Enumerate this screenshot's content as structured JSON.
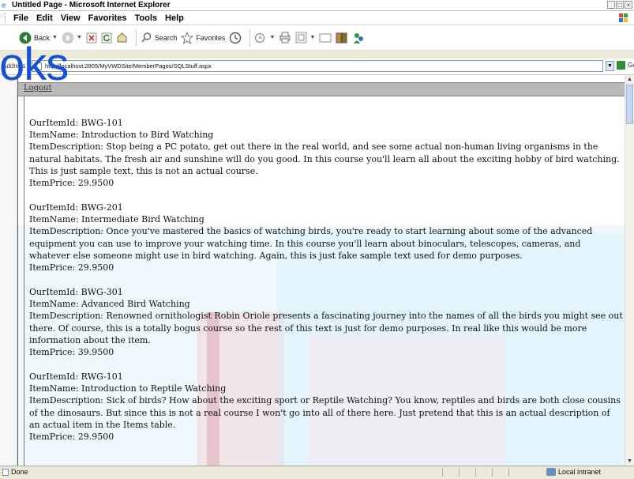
{
  "window": {
    "title": "Untitled Page - Microsoft Internet Explorer"
  },
  "menu": {
    "items": [
      "File",
      "Edit",
      "View",
      "Favorites",
      "Tools",
      "Help"
    ]
  },
  "toolbar": {
    "back_label": "Back",
    "search_label": "Search",
    "favorites_label": "Favorites"
  },
  "address": {
    "label": "Address",
    "url": "http://localhost:2805/MyVWDSite/MemberPages/SQLStuff.aspx",
    "go_label": "Go"
  },
  "watermark": {
    "logo_fragment": "oks"
  },
  "page": {
    "logout_label": "Logout",
    "records": [
      {
        "id": "OurItemId: BWG-101",
        "name": "ItemName: Introduction to Bird Watching",
        "description": "ItemDescription: Stop being a PC potato, get out there in the real world, and see some actual non-human living organisms in the natural habitats. The fresh air and sunshine will do you good. In this course you'll learn all about the exciting hobby of bird watching. This is just sample text, this is not an actual course.",
        "price": "ItemPrice: 29.9500"
      },
      {
        "id": "OurItemId: BWG-201",
        "name": "ItemName: Intermediate Bird Watching",
        "description": "ItemDescription: Once you've mastered the basics of watching birds, you're ready to start learning about some of the advanced equipment you can use to improve your watching time. In this course you'll learn about binoculars, telescopes, cameras, and whatever else someone might use in bird watching. Again, this is just fake sample text used for demo purposes.",
        "price": "ItemPrice: 29.9500"
      },
      {
        "id": "OurItemId: BWG-301",
        "name": "ItemName: Advanced Bird Watching",
        "description": "ItemDescription: Renowned ornithologist Robin Oriole presents a fascinating journey into the names of all the birds you might see out there. Of course, this is a totally bogus course so the rest of this text is just for demo purposes. In real like this would be more information about the item.",
        "price": "ItemPrice: 39.9500"
      },
      {
        "id": "OurItemId: RWG-101",
        "name": "ItemName: Introduction to Reptile Watching",
        "description": "ItemDescription: Sick of birds? How about the exciting sport or Reptile Watching? You know, reptiles and birds are both close cousins of the dinosaurs. But since this is not a real course I won't go into all of there here. Just pretend that this is an actual description of an actual item in the Items table.",
        "price": "ItemPrice: 29.9500"
      }
    ]
  },
  "status": {
    "text": "Done",
    "zone": "Local intranet"
  },
  "colors": {
    "logo_blue": "#1650d6",
    "watermark_teal": "#35b7d9",
    "watermark_red": "#c0304a"
  }
}
